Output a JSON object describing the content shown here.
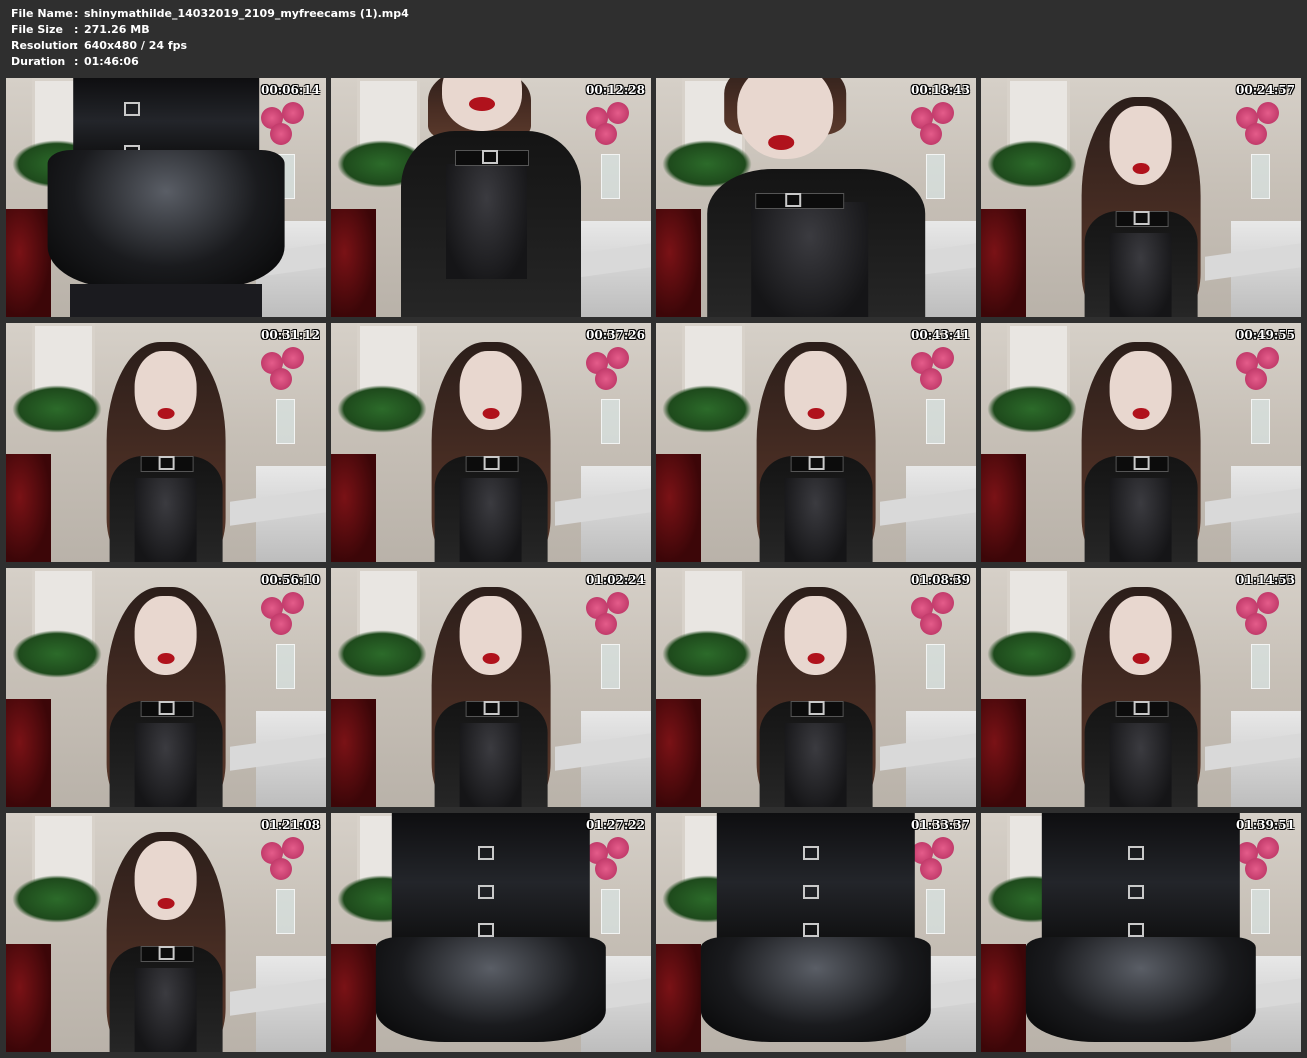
{
  "file_info": {
    "rows": [
      {
        "key": "File Name",
        "sep": ":",
        "value": "shinymathilde_14032019_2109_myfreecams (1).mp4"
      },
      {
        "key": "File Size",
        "sep": ":",
        "value": "271.26 MB"
      },
      {
        "key": "Resolution",
        "sep": ":",
        "value": "640x480 / 24 fps"
      },
      {
        "key": "Duration",
        "sep": ":",
        "value": "01:46:06"
      }
    ]
  },
  "thumbnails": [
    {
      "time": "00:06:14",
      "view": "skirt"
    },
    {
      "time": "00:12:28",
      "view": "closeup-left"
    },
    {
      "time": "00:18:43",
      "view": "closeup-tilt"
    },
    {
      "time": "00:24:57",
      "view": "portrait"
    },
    {
      "time": "00:31:12",
      "view": "portrait"
    },
    {
      "time": "00:37:26",
      "view": "portrait"
    },
    {
      "time": "00:43:41",
      "view": "portrait"
    },
    {
      "time": "00:49:55",
      "view": "portrait"
    },
    {
      "time": "00:56:10",
      "view": "portrait"
    },
    {
      "time": "01:02:24",
      "view": "portrait"
    },
    {
      "time": "01:08:39",
      "view": "portrait"
    },
    {
      "time": "01:14:53",
      "view": "portrait"
    },
    {
      "time": "01:21:08",
      "view": "portrait"
    },
    {
      "time": "01:27:22",
      "view": "corset"
    },
    {
      "time": "01:33:37",
      "view": "corset"
    },
    {
      "time": "01:39:51",
      "view": "corset"
    }
  ],
  "colors": {
    "background": "#2f2f2f",
    "text": "#ffffff"
  }
}
